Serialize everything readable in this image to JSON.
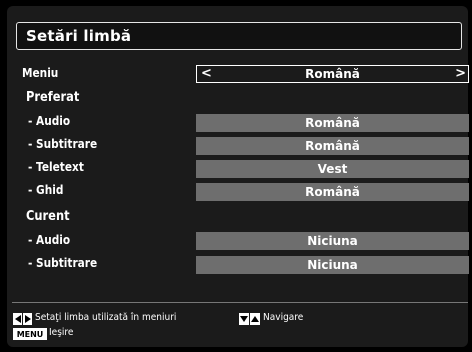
{
  "header": {
    "title": "Setări limbă"
  },
  "menu_row": {
    "label": "Meniu",
    "value": "Română",
    "left_arrow": "<",
    "right_arrow": ">"
  },
  "preferred": {
    "heading": "Preferat",
    "rows": [
      {
        "label": "- Audio",
        "value": "Română"
      },
      {
        "label": "- Subtitrare",
        "value": "Română"
      },
      {
        "label": "- Teletext",
        "value": "Vest"
      },
      {
        "label": "- Ghid",
        "value": "Română"
      }
    ]
  },
  "current": {
    "heading": "Curent",
    "rows": [
      {
        "label": "- Audio",
        "value": "Niciuna"
      },
      {
        "label": "- Subtitrare",
        "value": "Niciuna"
      }
    ]
  },
  "footer": {
    "set_language_hint": "Setaţi limba utilizată în meniuri",
    "navigate_hint": "Navigare",
    "menu_key": "MENU",
    "exit_hint": "Ieşire"
  },
  "icons": {
    "left_right_keys": "left-right-arrow-keys",
    "up_down_keys": "down-up-arrow-keys"
  }
}
